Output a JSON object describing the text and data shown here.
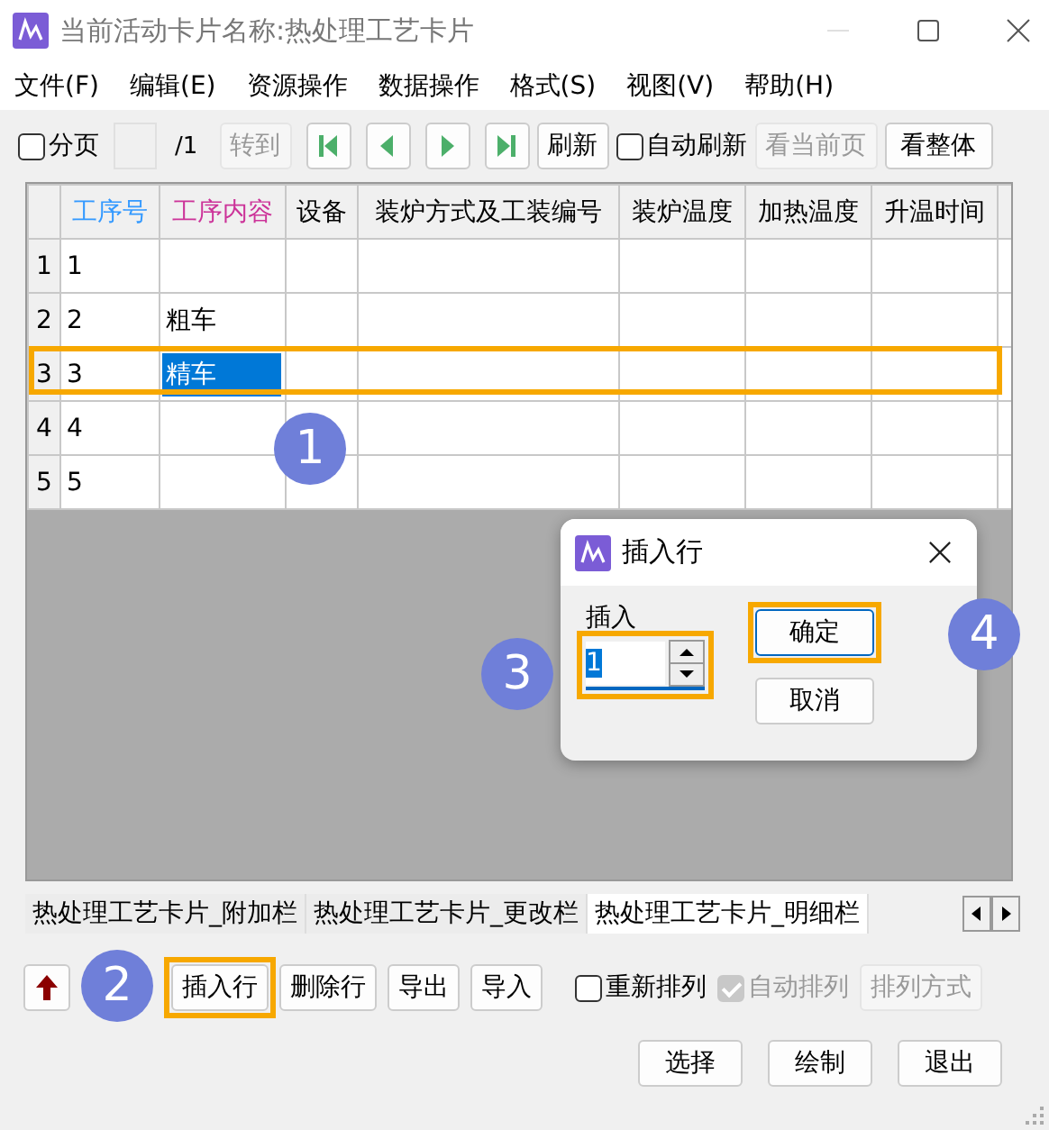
{
  "window": {
    "title": "当前活动卡片名称:热处理工艺卡片"
  },
  "menu": [
    "文件(F)",
    "编辑(E)",
    "资源操作",
    "数据操作",
    "格式(S)",
    "视图(V)",
    "帮助(H)"
  ],
  "toolbar": {
    "paging": {
      "label": "分页",
      "checked": false
    },
    "page_total": "/1",
    "goto": {
      "label": "转到",
      "disabled": true
    },
    "refresh": "刷新",
    "auto_refresh": {
      "label": "自动刷新",
      "checked": false
    },
    "view_current": {
      "label": "看当前页",
      "disabled": true
    },
    "view_all": {
      "label": "看整体",
      "disabled": false
    }
  },
  "table": {
    "columns": [
      {
        "label": "工序号",
        "color": "#3399ff"
      },
      {
        "label": "工序内容",
        "color": "#cc3399"
      },
      {
        "label": "设备",
        "color": "#000000"
      },
      {
        "label": "装炉方式及工装编号",
        "color": "#000000"
      },
      {
        "label": "装炉温度",
        "color": "#000000"
      },
      {
        "label": "加热温度",
        "color": "#000000"
      },
      {
        "label": "升温时间",
        "color": "#000000"
      }
    ],
    "rows": [
      {
        "header": "1",
        "highlighted": false,
        "cells": [
          {
            "text": "1",
            "selected": false
          }
        ]
      },
      {
        "header": "2",
        "highlighted": false,
        "cells": [
          {
            "text": "2",
            "selected": false
          },
          {
            "text": "粗车",
            "selected": false
          }
        ]
      },
      {
        "header": "3",
        "highlighted": true,
        "cells": [
          {
            "text": "3",
            "selected": false
          },
          {
            "text": "精车",
            "selected": true
          }
        ]
      },
      {
        "header": "4",
        "highlighted": false,
        "cells": [
          {
            "text": "4",
            "selected": false
          }
        ]
      },
      {
        "header": "5",
        "highlighted": false,
        "cells": [
          {
            "text": "5",
            "selected": false
          }
        ]
      }
    ]
  },
  "dialog": {
    "title": "插入行",
    "field_label": "插入",
    "field_value": "1",
    "field_highlighted": true,
    "ok": {
      "label": "确定",
      "highlighted": true
    },
    "cancel": {
      "label": "取消",
      "highlighted": false
    }
  },
  "sheet_tabs": [
    {
      "label": "热处理工艺卡片_附加栏",
      "selected": false
    },
    {
      "label": "热处理工艺卡片_更改栏",
      "selected": false
    },
    {
      "label": "热处理工艺卡片_明细栏",
      "selected": true
    }
  ],
  "row_buttons": [
    {
      "label": "插入行",
      "highlighted": true
    },
    {
      "label": "删除行",
      "highlighted": false
    },
    {
      "label": "导出",
      "highlighted": false
    },
    {
      "label": "导入",
      "highlighted": false
    }
  ],
  "sort_options": [
    {
      "label": "重新排列",
      "checked": false,
      "disabled": false
    },
    {
      "label": "自动排列",
      "checked": true,
      "disabled": true
    }
  ],
  "sort_mode": {
    "label": "排列方式",
    "disabled": true
  },
  "footer_buttons": [
    "选择",
    "绘制",
    "退出"
  ],
  "annotations": [
    "1",
    "2",
    "3",
    "4"
  ]
}
